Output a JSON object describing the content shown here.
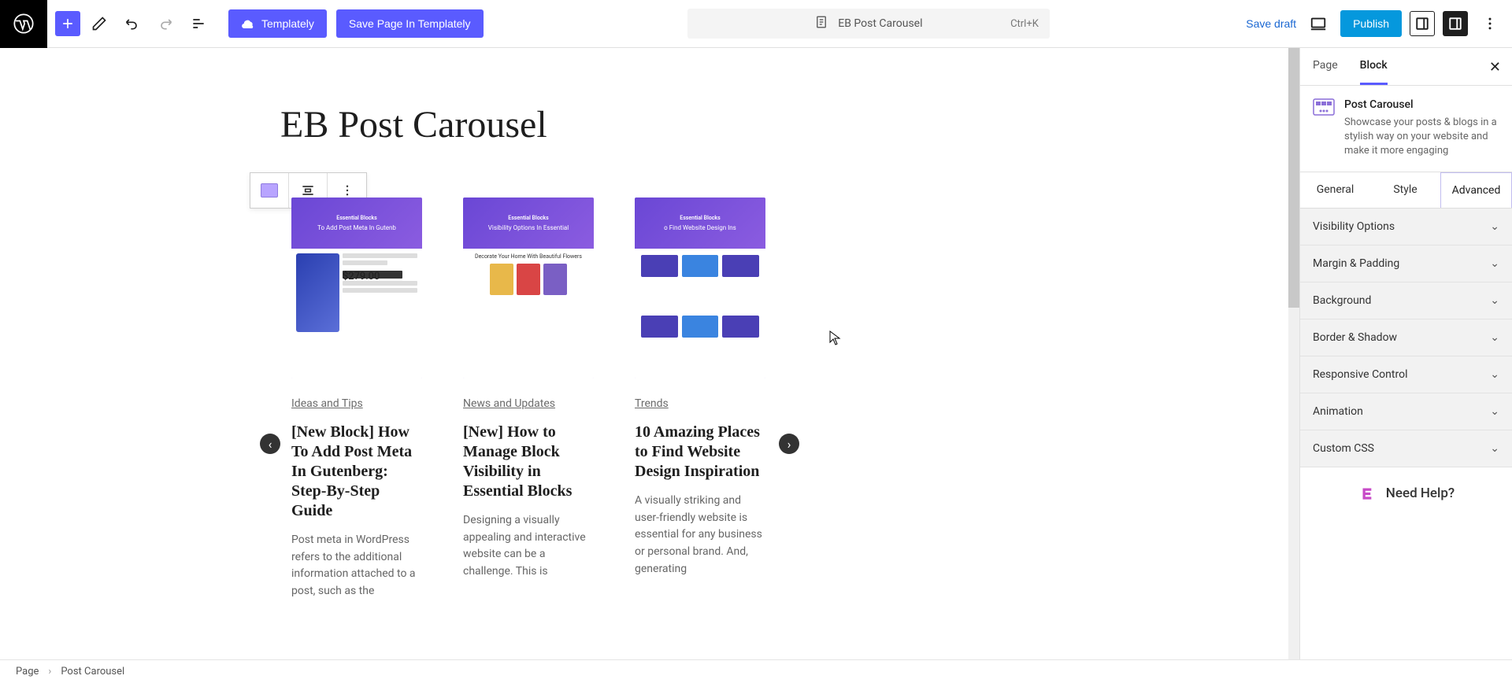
{
  "toolbar": {
    "templately_label": "Templately",
    "save_page_label": "Save Page In Templately",
    "doc_title": "EB Post Carousel",
    "shortcut": "Ctrl+K",
    "save_draft": "Save draft",
    "publish": "Publish"
  },
  "canvas": {
    "page_title": "EB Post Carousel",
    "cards": [
      {
        "thumb_headline": "To Add Post Meta In Gutenb",
        "category": "Ideas and Tips",
        "title": "[New Block] How To Add Post Meta In Gutenberg: Step-By-Step Guide",
        "excerpt": "Post meta in WordPress refers to the additional information attached to a post, such as the"
      },
      {
        "thumb_headline": "Visibility Options In Essential",
        "category": "News and Updates",
        "title": "[New] How to Manage Block Visibility in Essential Blocks",
        "excerpt": "Designing a visually appealing and interactive website can be a challenge. This is"
      },
      {
        "thumb_headline": "o Find Website Design Ins",
        "category": "Trends",
        "title": "10 Amazing Places to Find Website Design Inspiration",
        "excerpt": "A visually striking and user-friendly website is essential for any business or personal brand. And, generating"
      }
    ],
    "thumb_price": "$279.00",
    "thumb_decorate": "Decorate Your Home With Beautiful Flowers",
    "eb_logo": "Essential Blocks"
  },
  "sidebar": {
    "tabs": {
      "page": "Page",
      "block": "Block"
    },
    "block": {
      "name": "Post Carousel",
      "desc": "Showcase your posts & blogs in a stylish way on your website and make it more engaging"
    },
    "subtabs": {
      "general": "General",
      "style": "Style",
      "advanced": "Advanced"
    },
    "panels": [
      "Visibility Options",
      "Margin & Padding",
      "Background",
      "Border & Shadow",
      "Responsive Control",
      "Animation",
      "Custom CSS"
    ],
    "need_help": "Need Help?"
  },
  "breadcrumb": {
    "page": "Page",
    "block": "Post Carousel"
  }
}
